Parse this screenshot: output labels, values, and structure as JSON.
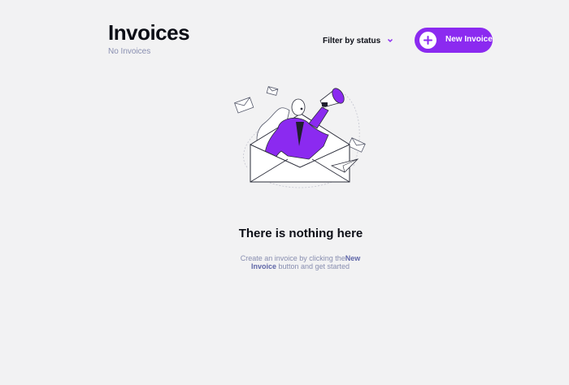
{
  "header": {
    "title": "Invoices",
    "subtitle": "No Invoices"
  },
  "filter": {
    "label": "Filter by status"
  },
  "new_invoice_button": {
    "label": "New Invoice"
  },
  "empty_state": {
    "title": "There is nothing here",
    "description_prefix": "Create an invoice by clicking the",
    "description_bold": "New Invoice",
    "description_suffix": " button and get started"
  },
  "colors": {
    "accent": "#8b2af0",
    "background": "#f2f2f3",
    "text_primary": "#0c0e16",
    "text_muted": "#888eb0"
  },
  "icons": {
    "filter_chevron": "chevron-down-icon",
    "new_button": "plus-icon",
    "illustration": "woman-with-megaphone-in-envelope"
  }
}
